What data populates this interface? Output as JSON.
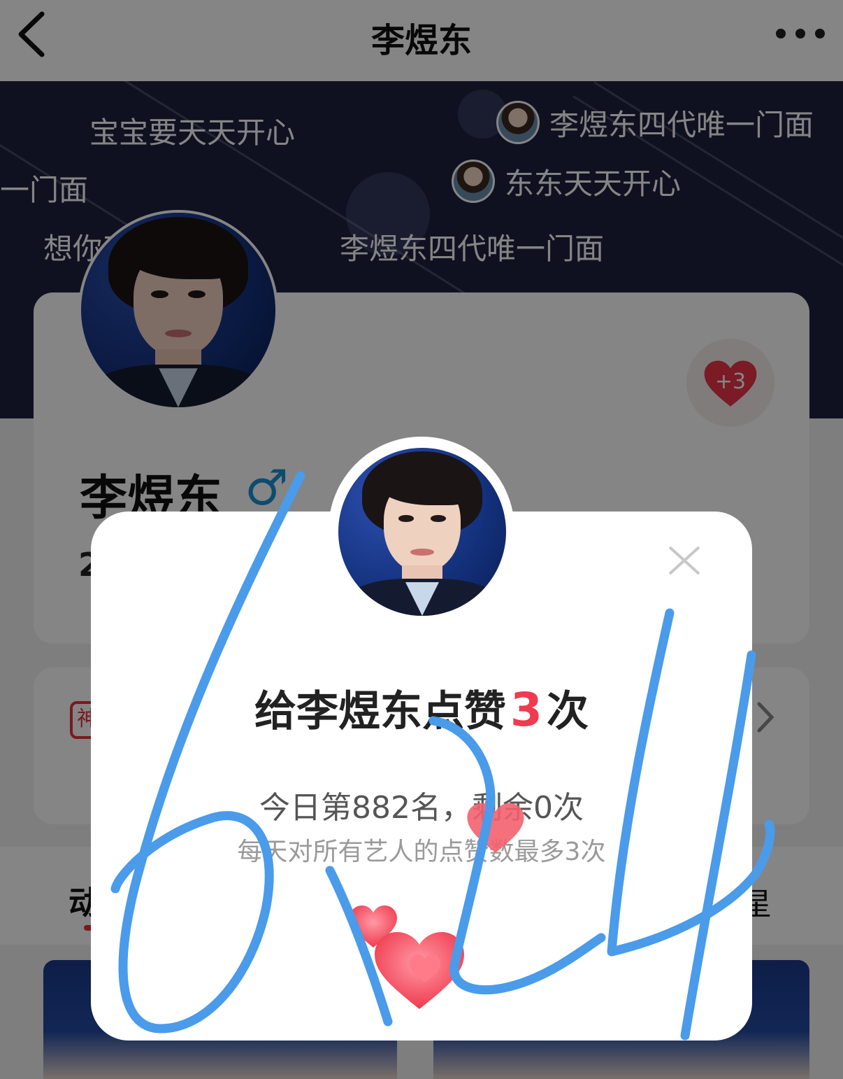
{
  "nav": {
    "title": "李煜东"
  },
  "danmaku": [
    "宝宝要天天开心",
    "李煜东四代唯一门面",
    "唯一门面",
    "东东天天开心",
    "想你了",
    "李煜东四代唯一门面"
  ],
  "profile": {
    "name": "李煜东",
    "gender_symbol": "♂",
    "like_badge": "+3",
    "partial_stat": "2"
  },
  "card2": {
    "tag": "神"
  },
  "tabs": {
    "left": "动",
    "right": "星"
  },
  "dialog": {
    "title_prefix": "给李煜东点赞",
    "title_count": "3",
    "title_suffix": "次",
    "rank_text": "今日第882名，剩余0次",
    "limit_text": "每天对所有艺人的点赞数最多3次"
  },
  "handwriting": "6 1 2 4",
  "colors": {
    "accent": "#f03a4e",
    "gender": "#1793d6",
    "banner": "#1e2140",
    "scribble": "#4a9bea"
  }
}
